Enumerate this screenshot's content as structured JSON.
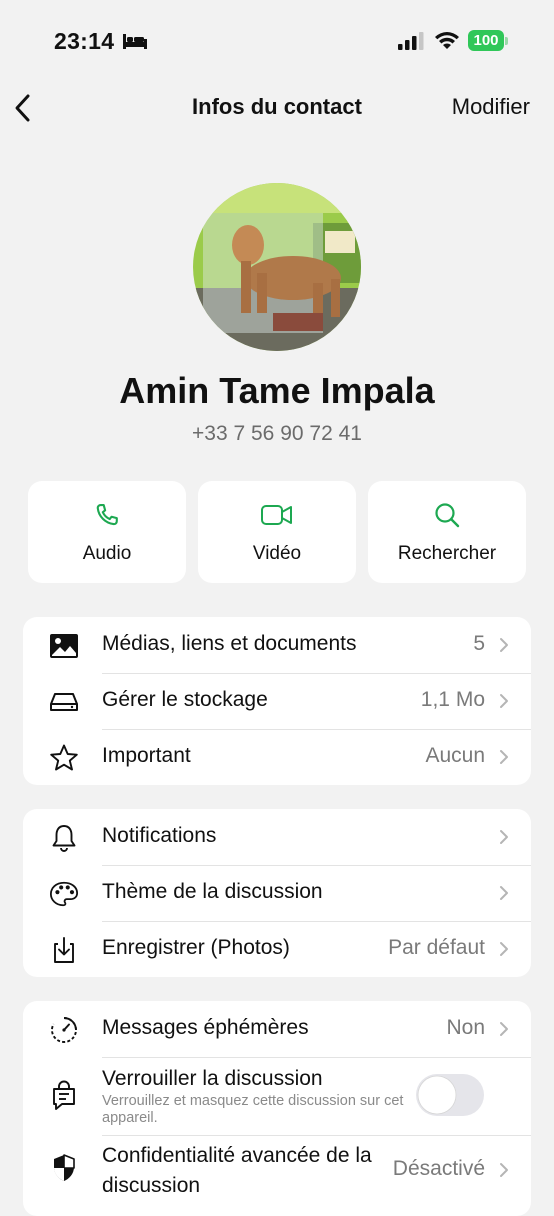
{
  "status": {
    "time": "23:14",
    "battery": "100"
  },
  "nav": {
    "title": "Infos du contact",
    "edit": "Modifier"
  },
  "contact": {
    "name": "Amin Tame Impala",
    "phone": "+33 7 56 90 72 41"
  },
  "actions": [
    {
      "label": "Audio",
      "icon": "phone-icon"
    },
    {
      "label": "Vidéo",
      "icon": "video-icon"
    },
    {
      "label": "Rechercher",
      "icon": "search-icon"
    }
  ],
  "section1": [
    {
      "label": "Médias, liens et documents",
      "value": "5",
      "icon": "image-icon"
    },
    {
      "label": "Gérer le stockage",
      "value": "1,1 Mo",
      "icon": "storage-icon"
    },
    {
      "label": "Important",
      "value": "Aucun",
      "icon": "star-icon"
    }
  ],
  "section2": [
    {
      "label": "Notifications",
      "value": "",
      "icon": "bell-icon"
    },
    {
      "label": "Thème de la discussion",
      "value": "",
      "icon": "palette-icon"
    },
    {
      "label": "Enregistrer (Photos)",
      "value": "Par défaut",
      "icon": "download-icon"
    }
  ],
  "section3": {
    "ephemeral": {
      "label": "Messages éphémères",
      "value": "Non",
      "icon": "timer-icon"
    },
    "lock": {
      "label": "Verrouiller la discussion",
      "sub": "Verrouillez et masquez cette discussion sur cet appareil.",
      "toggle": false,
      "icon": "lock-chat-icon"
    },
    "privacy": {
      "label": "Confidentialité avancée de la discussion",
      "value": "Désactivé",
      "icon": "shield-icon"
    }
  },
  "colors": {
    "accent": "#1DA851",
    "background": "#F2F2F2",
    "battery": "#30C759"
  }
}
